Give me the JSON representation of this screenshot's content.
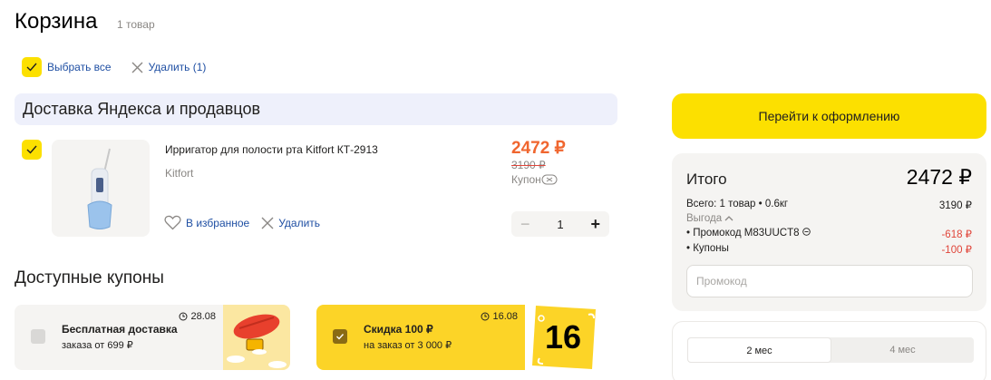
{
  "page": {
    "title": "Корзина",
    "count": "1 товар"
  },
  "toolbar": {
    "select_all": "Выбрать все",
    "delete": "Удалить (1)"
  },
  "delivery": {
    "title": "Доставка Яндекса и продавцов"
  },
  "item": {
    "title": "Ирригатор для полости рта Kitfort КТ-2913",
    "brand": "Kitfort",
    "price": "2472 ₽",
    "old_price": "3190 ₽",
    "coupon_label": "Купон",
    "favorite": "В избранное",
    "delete": "Удалить",
    "quantity": "1",
    "minus": "−",
    "plus": "+"
  },
  "coupons": {
    "title": "Доступные купоны",
    "items": [
      {
        "name": "Бесплатная доставка",
        "condition": "заказа от 699 ₽",
        "date": "28.08",
        "selected": false
      },
      {
        "name": "Скидка 100 ₽",
        "condition": "на заказ от 3 000 ₽",
        "date": "16.08",
        "selected": true,
        "badge": "16"
      }
    ]
  },
  "checkout": {
    "label": "Перейти к оформлению"
  },
  "summary": {
    "title": "Итого",
    "total": "2472 ₽",
    "all_label": "Всего: 1 товар • 0.6кг",
    "all_value": "3190 ₽",
    "benefit_label": "Выгода",
    "promo_label": "• Промокод M83UUCT8",
    "promo_value": "-618 ₽",
    "coupons_label": "• Купоны",
    "coupons_value": "-100 ₽",
    "promo_placeholder": "Промокод"
  },
  "plan": {
    "tabs": [
      "2 мес",
      "4 мес"
    ],
    "active": 0
  },
  "colors": {
    "accent": "#fce000",
    "price": "#f0662f",
    "link": "#1f4fa3",
    "negative": "#e0453a"
  }
}
